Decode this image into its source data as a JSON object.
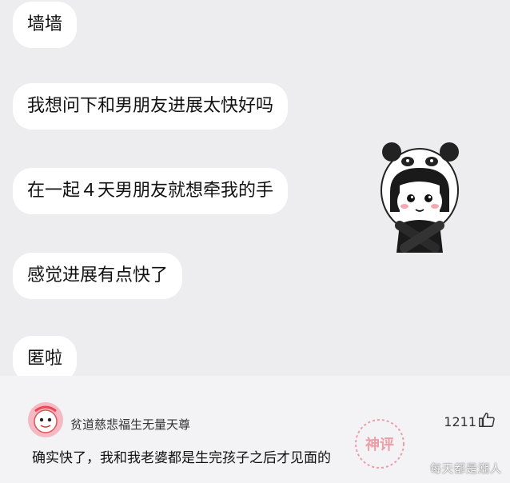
{
  "messages": [
    "墙墙",
    "我想问下和男朋友进展太快好吗",
    "在一起４天男朋友就想牵我的手",
    "感觉进展有点快了",
    "匿啦"
  ],
  "comment": {
    "username": "贫道慈悲福生无量天尊",
    "likes": "1211",
    "text": "确实快了，我和我老婆都是生完孩子之后才见面的"
  },
  "stamp_text": "神评",
  "watermark": "每天都是潮人",
  "icons": {
    "sticker": "panda-girl-sticker",
    "avatar": "cartoon-avatar-icon",
    "like": "thumbs-up-icon"
  },
  "colors": {
    "chat_background": "#ededf0",
    "bubble": "#ffffff",
    "comment_background": "#f3f3f5",
    "stamp": "#e35a6a"
  }
}
